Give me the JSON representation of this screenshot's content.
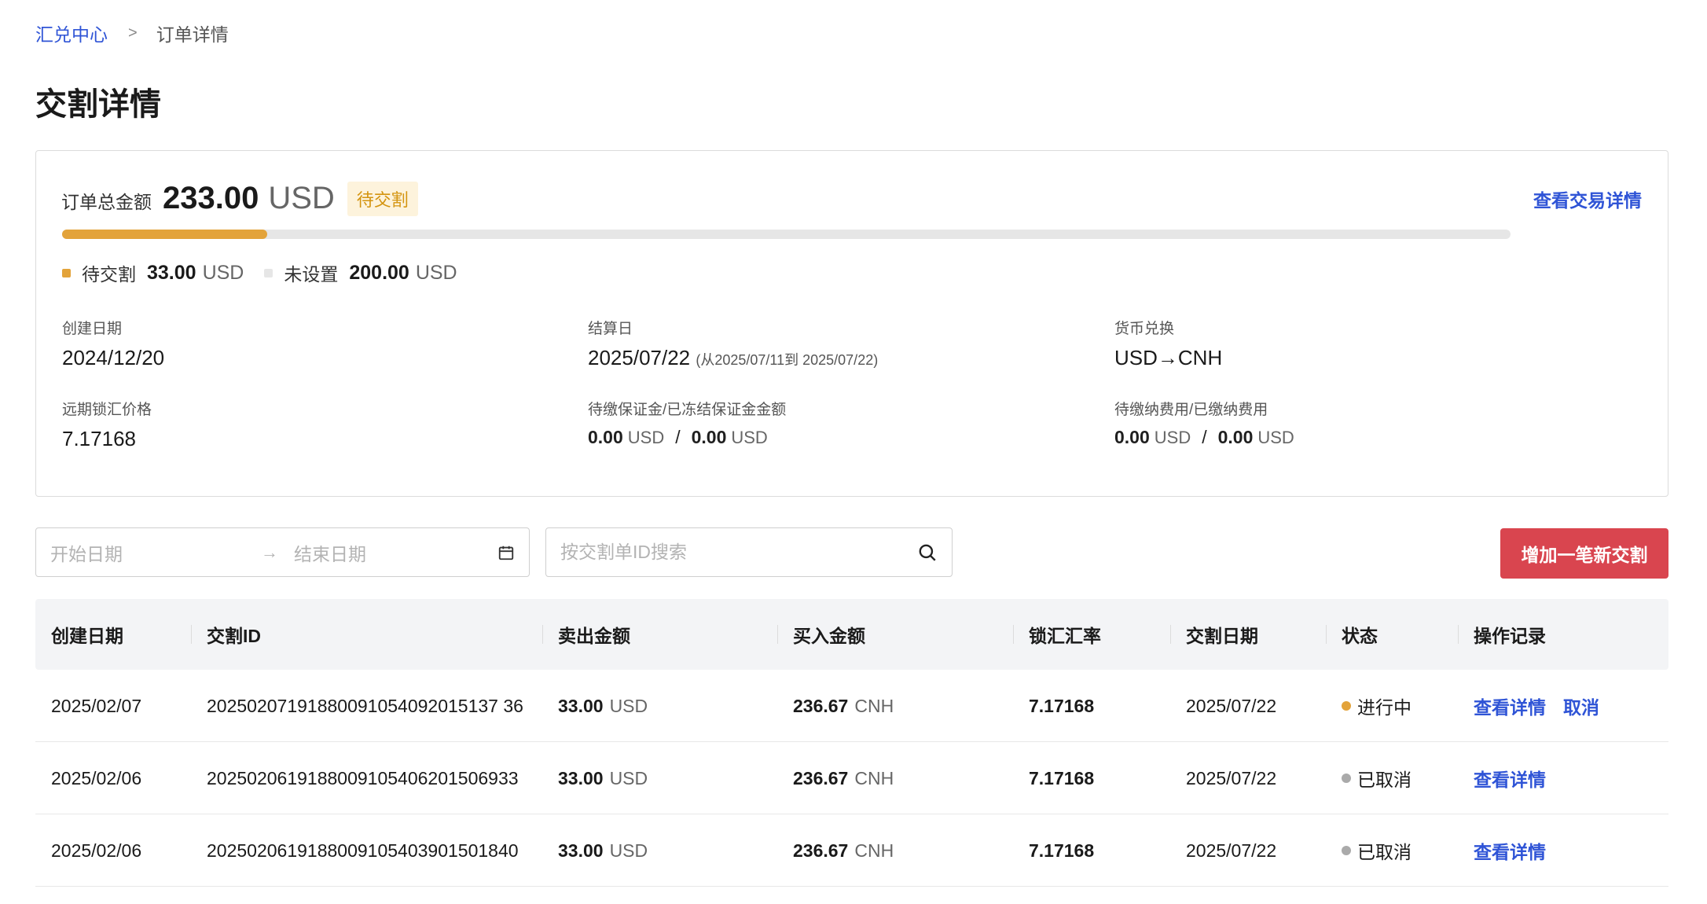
{
  "breadcrumb": {
    "home": "汇兑中心",
    "separator": ">",
    "current": "订单详情"
  },
  "page_title": "交割详情",
  "summary": {
    "total_label": "订单总金额",
    "total_amount": "233.00",
    "total_currency": "USD",
    "status": "待交割",
    "view_trade_link": "查看交易详情",
    "progress_fraction": 0.1416,
    "legend": [
      {
        "label": "待交割",
        "value": "33.00",
        "currency": "USD",
        "color": "#e3a33a"
      },
      {
        "label": "未设置",
        "value": "200.00",
        "currency": "USD",
        "color": "#e6e6e6"
      }
    ],
    "info": {
      "created_label": "创建日期",
      "created_value": "2024/12/20",
      "settlement_label": "结算日",
      "settlement_value": "2025/07/22",
      "settlement_note": "(从2025/07/11到 2025/07/22)",
      "currency_label": "货币兑换",
      "currency_value": "USD→CNH",
      "forward_label": "远期锁汇价格",
      "forward_value": "7.17168",
      "margin_label": "待缴保证金/已冻结保证金金额",
      "margin_due": "0.00",
      "margin_due_cur": "USD",
      "margin_frozen": "0.00",
      "margin_frozen_cur": "USD",
      "fee_label": "待缴纳费用/已缴纳费用",
      "fee_due": "0.00",
      "fee_due_cur": "USD",
      "fee_paid": "0.00",
      "fee_paid_cur": "USD",
      "slash": "/"
    }
  },
  "filters": {
    "start_placeholder": "开始日期",
    "arrow": "→",
    "end_placeholder": "结束日期",
    "search_placeholder": "按交割单ID搜索",
    "add_button": "增加一笔新交割"
  },
  "table": {
    "headers": [
      "创建日期",
      "交割ID",
      "卖出金额",
      "买入金额",
      "锁汇汇率",
      "交割日期",
      "状态",
      "操作记录"
    ],
    "rows": [
      {
        "created": "2025/02/07",
        "id": "20250207191880091054092015137 36",
        "sell": "33.00",
        "sell_cur": "USD",
        "buy": "236.67",
        "buy_cur": "CNH",
        "rate": "7.17168",
        "date": "2025/07/22",
        "status": "进行中",
        "status_color": "#e3a33a",
        "actions": [
          "查看详情",
          "取消"
        ]
      },
      {
        "created": "2025/02/06",
        "id": "2025020619188009105406201506933",
        "sell": "33.00",
        "sell_cur": "USD",
        "buy": "236.67",
        "buy_cur": "CNH",
        "rate": "7.17168",
        "date": "2025/07/22",
        "status": "已取消",
        "status_color": "#aaaaaa",
        "actions": [
          "查看详情"
        ]
      },
      {
        "created": "2025/02/06",
        "id": "2025020619188009105403901501840",
        "sell": "33.00",
        "sell_cur": "USD",
        "buy": "236.67",
        "buy_cur": "CNH",
        "rate": "7.17168",
        "date": "2025/07/22",
        "status": "已取消",
        "status_color": "#aaaaaa",
        "actions": [
          "查看详情"
        ]
      }
    ]
  }
}
